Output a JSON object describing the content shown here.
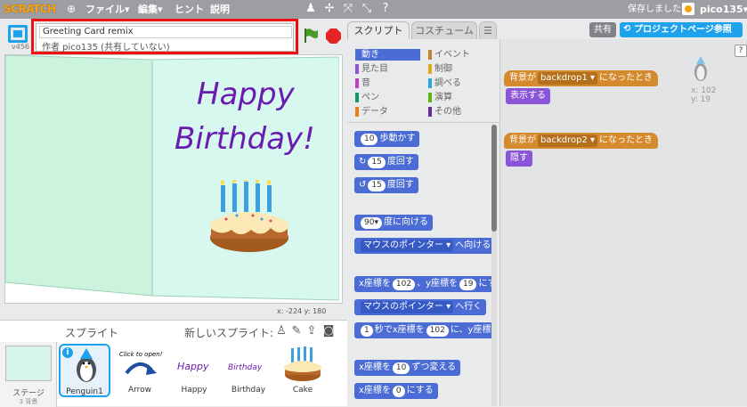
{
  "topbar": {
    "logo": "SCRATCH",
    "menus": [
      "ファイル▾",
      "編集▾",
      "ヒント",
      "説明"
    ],
    "saved": "保存しました",
    "username": "pico135▾"
  },
  "project": {
    "title": "Greeting Card remix",
    "author": "作者 pico135 (共有していない)",
    "version": "v456"
  },
  "stage": {
    "text_line1": "Happy",
    "text_line2": "Birthday!",
    "coords": "x: -224  y: 180"
  },
  "sprites": {
    "heading": "スプライト",
    "new_sprite": "新しいスプライト:",
    "stage_label": "ステージ",
    "stage_bg": "3 背景",
    "items": [
      {
        "name": "Penguin1"
      },
      {
        "name": "Arrow"
      },
      {
        "name": "Happy"
      },
      {
        "name": "Birthday"
      },
      {
        "name": "Cake"
      }
    ],
    "arrow_caption": "Click to open!",
    "happy_caption": "Happy",
    "birthday_caption": "Birthday"
  },
  "tabs": {
    "script": "スクリプト",
    "costume": "コスチューム",
    "sound_icon": "speaker-icon"
  },
  "categories": {
    "left": [
      "動き",
      "見た目",
      "音",
      "ペン",
      "データ"
    ],
    "right": [
      "イベント",
      "制御",
      "調べる",
      "演算",
      "その他"
    ],
    "colors": [
      "#4a6cd4",
      "#8a55d7",
      "#bb42c3",
      "#0e9a6c",
      "#ee7d16",
      "#c88330",
      "#e1a91a",
      "#2ca5e2",
      "#5cb712",
      "#632d99"
    ]
  },
  "blocks": {
    "move": {
      "num": "10",
      "label": "歩動かす"
    },
    "turn_right": {
      "num": "15",
      "label": "度回す"
    },
    "turn_left": {
      "num": "15",
      "label": "度回す"
    },
    "point_dir": {
      "num": "90▾",
      "label": "度に向ける"
    },
    "point_towards": {
      "dd": "マウスのポインター ▾",
      "label": "へ向ける"
    },
    "goto_xy": {
      "a": "x座標を",
      "x": "102",
      "b": "、y座標を",
      "y": "19",
      "c": "にす"
    },
    "goto": {
      "dd": "マウスのポインター ▾",
      "label": "へ行く"
    },
    "glide": {
      "sec": "1",
      "a": "秒でx座標を",
      "x": "102",
      "b": "に、y座標を"
    },
    "change_x": {
      "a": "x座標を",
      "n": "10",
      "b": "ずつ変える"
    },
    "set_x": {
      "a": "x座標を",
      "n": "0",
      "b": "にする"
    }
  },
  "script": {
    "share": "共有",
    "project_page": "プロジェクトページ参照",
    "help": "?",
    "ev1": {
      "a": "背景が",
      "dd": "backdrop1 ▾",
      "b": "になったとき"
    },
    "lk1": "表示する",
    "ev2": {
      "a": "背景が",
      "dd": "backdrop2 ▾",
      "b": "になったとき"
    },
    "lk2": "隠す",
    "sprite_x": "x: 102",
    "sprite_y": "y: 19"
  }
}
